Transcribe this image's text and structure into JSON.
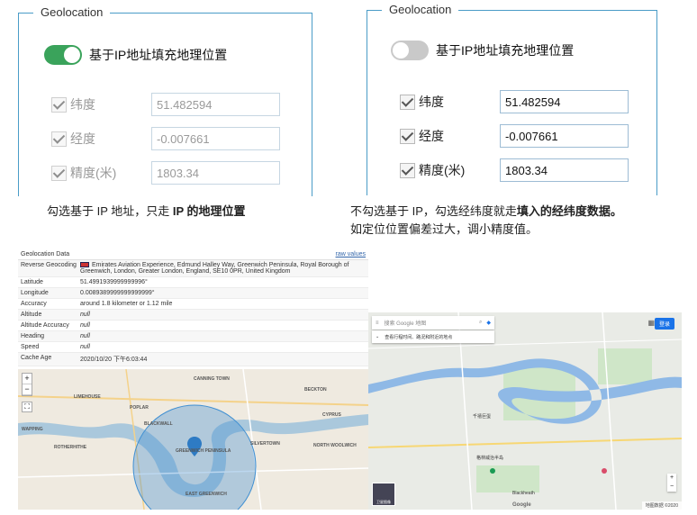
{
  "left_panel": {
    "title": "Geolocation",
    "toggle_label": "基于IP地址填充地理位置",
    "toggle_on": true,
    "fields": [
      {
        "label": "纬度",
        "value": "51.482594"
      },
      {
        "label": "经度",
        "value": "-0.007661"
      },
      {
        "label": "精度(米)",
        "value": "1803.34"
      }
    ]
  },
  "right_panel": {
    "title": "Geolocation",
    "toggle_label": "基于IP地址填充地理位置",
    "toggle_on": false,
    "fields": [
      {
        "label": "纬度",
        "value": "51.482594"
      },
      {
        "label": "经度",
        "value": "-0.007661"
      },
      {
        "label": "精度(米)",
        "value": "1803.34"
      }
    ]
  },
  "captions": {
    "left_plain": "勾选基于 IP 地址，只走 ",
    "left_bold": "IP 的地理位置",
    "right_plain": "不勾选基于 IP，勾选经纬度就走",
    "right_bold": "填入的经纬度数据。",
    "right_line2": "如定位位置偏差过大，调小精度值。"
  },
  "geo_data": {
    "header": "Geolocation Data",
    "raw_link": "raw values",
    "rows": [
      {
        "key": "Reverse Geocoding",
        "value": "Emirates Aviation Experience, Edmund Halley Way, Greenwich Peninsula, Royal Borough of Greenwich, London, Greater London, England, SE10 0PR, United Kingdom"
      },
      {
        "key": "Latitude",
        "value": "51.4991939999999996°"
      },
      {
        "key": "Longitude",
        "value": "0.0089389999999999999°"
      },
      {
        "key": "Accuracy",
        "value": "around 1.8 kilometer or 1.12 mile"
      },
      {
        "key": "Altitude",
        "value": "null"
      },
      {
        "key": "Altitude Accuracy",
        "value": "null"
      },
      {
        "key": "Heading",
        "value": "null"
      },
      {
        "key": "Speed",
        "value": "null"
      },
      {
        "key": "Cache Age",
        "value": "2020/10/20 下午6:03:44"
      }
    ]
  },
  "left_map": {
    "zoom_in": "+",
    "zoom_out": "−",
    "fullscreen": "⛶",
    "labels": [
      {
        "text": "CANNING TOWN"
      },
      {
        "text": "BECKTON"
      },
      {
        "text": "LIMEHOUSE"
      },
      {
        "text": "POPLAR"
      },
      {
        "text": "BLACKWALL"
      },
      {
        "text": "CYPRUS"
      },
      {
        "text": "WAPPING"
      },
      {
        "text": "ROTHERHITHE"
      },
      {
        "text": "GREENWICH PENINSULA"
      },
      {
        "text": "SILVERTOWN"
      },
      {
        "text": "NORTH WOOLWICH"
      },
      {
        "text": "EAST GREENWICH"
      }
    ]
  },
  "right_map": {
    "search_placeholder": "搜索 Google 地图",
    "sub_text": "查看行程时间、路況和附近的地点",
    "login": "登录",
    "thumb_label": "卫星图像",
    "footer": "地图数据 ©2020",
    "logo": "Google",
    "labels": [
      {
        "text": "千禧巨蛋"
      },
      {
        "text": "格林威治半岛"
      },
      {
        "text": "Blackheath"
      }
    ]
  },
  "colors": {
    "accent_border": "#4a9cc7",
    "toggle_on": "#3aa35b",
    "toggle_off": "#c9c9c9",
    "water": "#7fb4d6",
    "river_google": "#8fb9e6"
  }
}
